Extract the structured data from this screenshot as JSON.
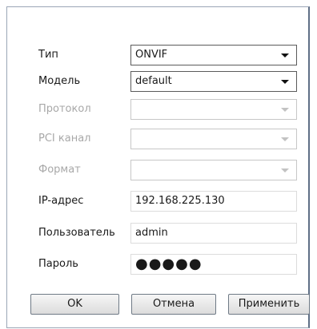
{
  "form": {
    "type": {
      "label": "Тип",
      "value": "ONVIF"
    },
    "model": {
      "label": "Модель",
      "value": "default"
    },
    "protocol": {
      "label": "Протокол",
      "value": ""
    },
    "pci_channel": {
      "label": "PCI канал",
      "value": ""
    },
    "format": {
      "label": "Формат",
      "value": ""
    },
    "ip_address": {
      "label": "IP-адрес",
      "value": "192.168.225.130"
    },
    "user": {
      "label": "Пользователь",
      "value": "admin"
    },
    "password": {
      "label": "Пароль",
      "value": "●●●●●"
    }
  },
  "buttons": {
    "ok": "OK",
    "cancel": "Отмена",
    "apply": "Применить"
  }
}
